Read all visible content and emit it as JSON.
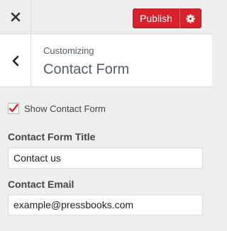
{
  "topbar": {
    "close_icon": "close-x-icon",
    "publish_label": "Publish",
    "publish_settings_icon": "gear-icon",
    "accent_color": "#d8212b"
  },
  "header": {
    "back_icon": "chevron-left-icon",
    "breadcrumb": "Customizing",
    "title": "Contact Form"
  },
  "form": {
    "show_contact_form": {
      "label": "Show Contact Form",
      "checked": true,
      "check_color": "#d8212b"
    },
    "contact_form_title": {
      "label": "Contact Form Title",
      "value": "Contact us"
    },
    "contact_email": {
      "label": "Contact Email",
      "value": "example@pressbooks.com"
    }
  }
}
